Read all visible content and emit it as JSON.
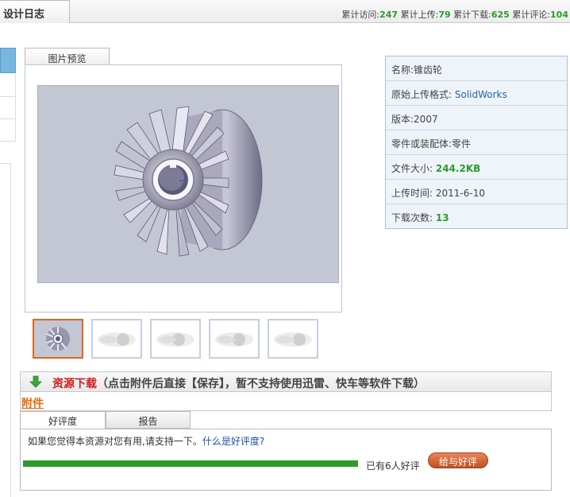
{
  "header": {
    "tab_title": "设计日志",
    "stats": [
      {
        "label": "累计访问:",
        "value": "247"
      },
      {
        "label": "累计上传:",
        "value": "79"
      },
      {
        "label": "累计下载:",
        "value": "625"
      },
      {
        "label": "累计评论:",
        "value": "104"
      }
    ]
  },
  "preview": {
    "tab_label": "图片预览",
    "thumbnail_count": 5
  },
  "info": {
    "rows": [
      {
        "label": "名称:",
        "value": "锥齿轮"
      },
      {
        "label": "原始上传格式: ",
        "value": "SolidWorks"
      },
      {
        "label": "版本:",
        "value": "2007"
      },
      {
        "label": "零件或装配体:",
        "value": "零件"
      },
      {
        "label": "文件大小: ",
        "value": "244.2KB"
      },
      {
        "label": "上传时间: ",
        "value": "2011-6-10"
      },
      {
        "label": "下载次数: ",
        "value": "13"
      }
    ]
  },
  "download": {
    "title": "资源下载",
    "note": "（点击附件后直接【保存】，暂不支持使用迅雷、快车等软件下载）",
    "attachment_label": "附件"
  },
  "rating": {
    "tab_good": "好评度",
    "tab_report": "报告",
    "prompt": "如果您觉得本资源对您有用,请支持一下。",
    "what_is": "什么是好评度?",
    "progress": 1.0,
    "count_text": "已有6人好评",
    "button_label": "给与好评"
  },
  "colors": {
    "accent_green": "#2a9b2a",
    "accent_orange": "#e06b0e",
    "info_bg": "#eef4f9",
    "button": "#d0602d"
  }
}
